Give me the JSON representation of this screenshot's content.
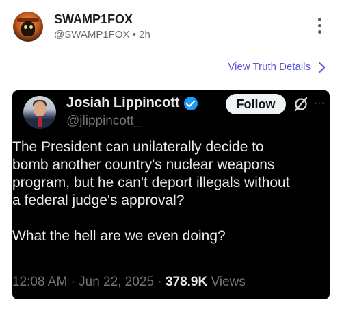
{
  "post": {
    "display_name": "SWAMP1FOX",
    "handle": "@SWAMP1FOX",
    "separator": "•",
    "time": "2h",
    "details_link": "View Truth Details"
  },
  "tweet": {
    "name": "Josiah Lippincott",
    "handle": "@jlippincott_",
    "follow_label": "Follow",
    "more": "···",
    "body_lines": [
      "The President can unilaterally decide to",
      "bomb another country's nuclear weapons",
      "program, but he can't deport illegals without",
      "a federal judge's approval?"
    ],
    "body_second": "What the hell are we even doing?",
    "time": "12:08 AM",
    "dot1": "·",
    "date": "Jun 22, 2025",
    "dot2": "·",
    "views_count": "378.9K",
    "views_label": "Views"
  },
  "icons": [
    "kebab-menu-icon",
    "chevron-right-icon",
    "verified-badge-icon",
    "grok-icon",
    "more-icon"
  ],
  "colors": {
    "link": "#5b56d6",
    "verified": "#1d9bf0",
    "card_bg": "#000000"
  }
}
